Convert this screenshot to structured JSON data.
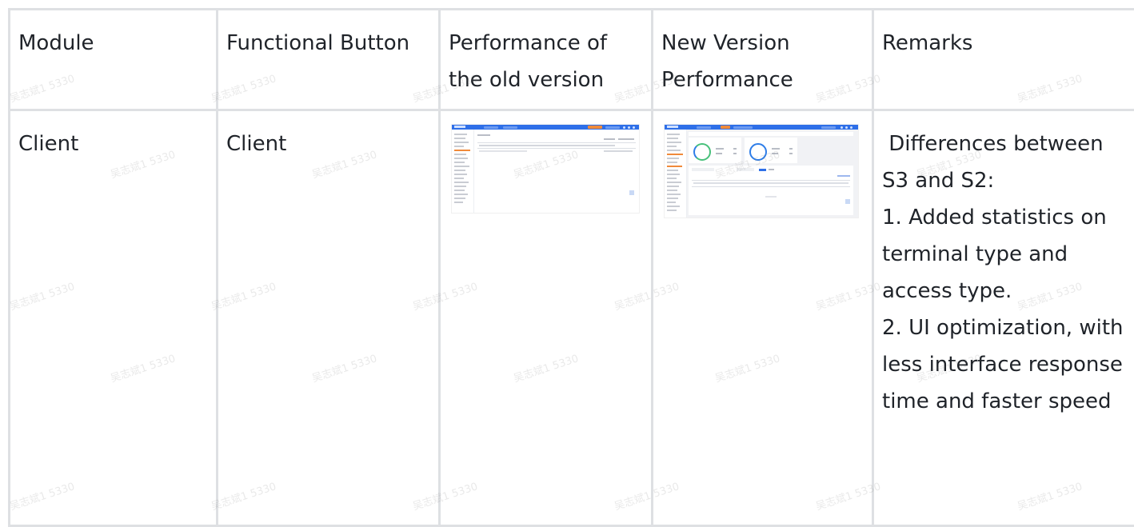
{
  "table": {
    "headers": [
      "Module",
      "Functional Button",
      "Performance of the old version",
      "New Version Performance",
      "Remarks"
    ],
    "row": {
      "module": "Client",
      "functional_button": "Client",
      "remarks": [
        " Differences between S3 and S2:",
        "1. Added statistics on terminal type and access type.",
        "2. UI optimization, with less interface response time and faster speed"
      ]
    }
  },
  "watermark": "吴志斌1 5330"
}
